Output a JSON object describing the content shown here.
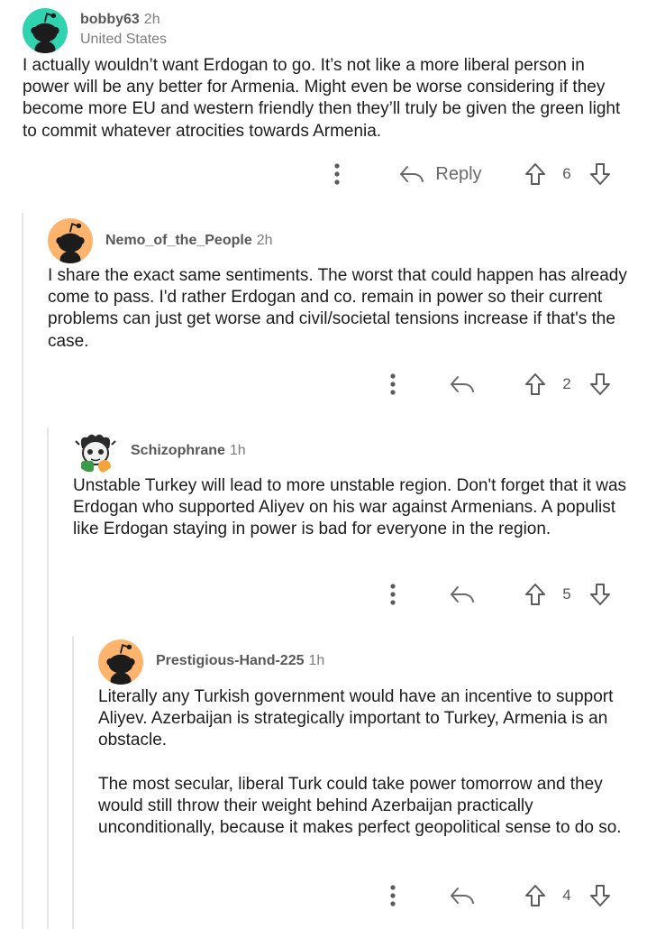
{
  "comments": [
    {
      "author": "bobby63",
      "time": "2h",
      "flair": "United States",
      "body": [
        "I actually wouldn’t want Erdogan to go. It’s not like a more liberal person in power will be any better for Armenia. Might even be worse considering if they become more EU and western friendly then they’ll truly be given the green light to commit whatever atrocities towards Armenia."
      ],
      "reply_label": "Reply",
      "score": "6"
    },
    {
      "author": "Nemo_of_the_People",
      "time": "2h",
      "body": [
        "I share the exact same sentiments. The worst that could happen has already come to pass. I'd rather Erdogan and co. remain in power so their current problems can just get worse and civil/societal tensions increase if that's the case."
      ],
      "score": "2"
    },
    {
      "author": "Schizophrane",
      "time": "1h",
      "body": [
        "Unstable Turkey will lead to more unstable region. Don't forget that it was Erdogan who supported Aliyev on his war against Armenians. A populist like Erdogan staying in power is bad for everyone in the region."
      ],
      "score": "5"
    },
    {
      "author": "Prestigious-Hand-225",
      "time": "1h",
      "body": [
        "Literally any Turkish government would have an incentive to support Aliyev. Azerbaijan is strategically important to Turkey, Armenia is an obstacle.",
        "The most secular, liberal Turk could take power tomorrow and they would still throw their weight behind Azerbaijan practically unconditionally, because it makes perfect geopolitical sense to do so."
      ],
      "score": "4"
    }
  ],
  "icons": {
    "more": "more-options-icon",
    "reply": "reply-arrow-icon",
    "upvote": "upvote-arrow-icon",
    "downvote": "downvote-arrow-icon"
  },
  "colors": {
    "avatar_teal": "#2fd3b0",
    "avatar_orange": "#ffb46e",
    "thread_line": "#e6e6e6",
    "text": "#1c1c1c",
    "meta": "#7c7c7c"
  }
}
